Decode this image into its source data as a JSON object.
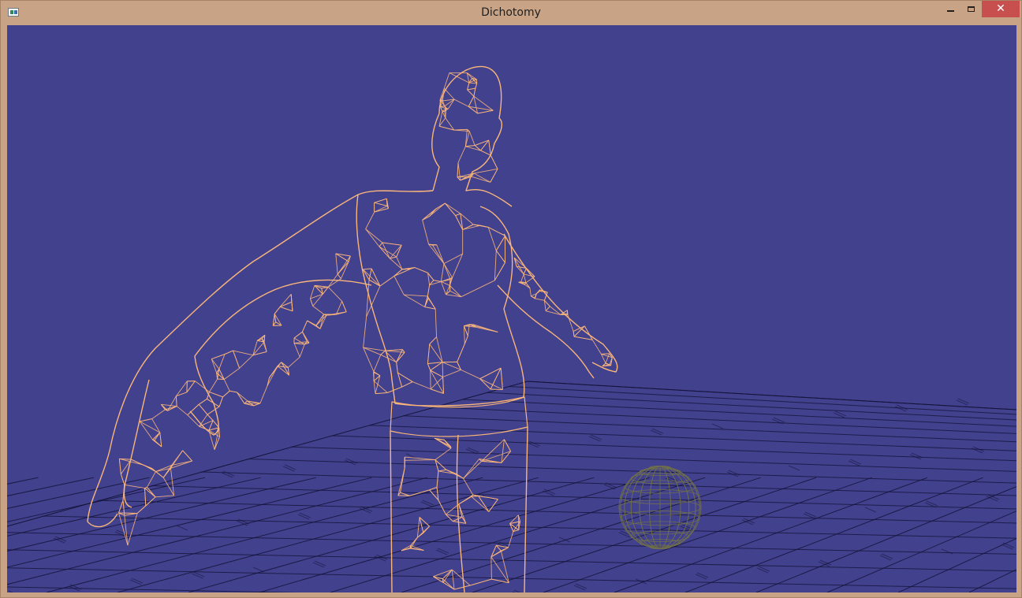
{
  "window": {
    "title": "Dichotomy",
    "close_glyph": "✕"
  },
  "icons": {
    "app": "app-window-icon",
    "minimize": "minimize-icon",
    "maximize": "maximize-icon",
    "close": "close-icon"
  },
  "colors": {
    "titlebar": "#c9a385",
    "close_button": "#c7504f",
    "viewport_background": "#42418e",
    "character_wireframe": "#f9b57a",
    "grid_lines": "#14143a",
    "sphere_wireframe": "#6f6f4a"
  }
}
